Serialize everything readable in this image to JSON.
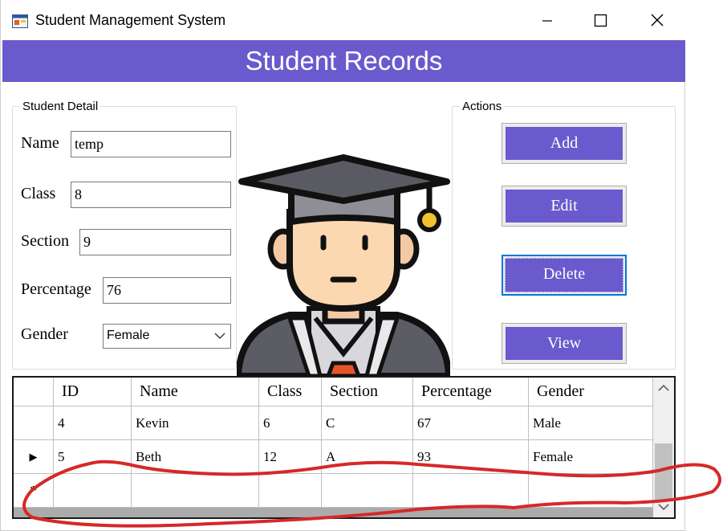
{
  "window": {
    "title": "Student Management System",
    "icons": {
      "app": "app-form-icon",
      "minimize": "minimize-icon",
      "maximize": "maximize-icon",
      "close": "close-icon"
    }
  },
  "banner": {
    "title": "Student Records",
    "color": "#6a5acd"
  },
  "student_detail": {
    "legend": "Student Detail",
    "name": {
      "label": "Name",
      "value": "temp"
    },
    "class": {
      "label": "Class",
      "value": "8"
    },
    "section": {
      "label": "Section",
      "value": "9"
    },
    "percentage": {
      "label": "Percentage",
      "value": "76"
    },
    "gender": {
      "label": "Gender",
      "selected": "Female"
    }
  },
  "actions": {
    "legend": "Actions",
    "add": "Add",
    "edit": "Edit",
    "delete": "Delete",
    "view": "View",
    "button_color": "#6a5acd"
  },
  "mascot": {
    "icon": "graduate-student-icon"
  },
  "grid": {
    "columns": [
      "ID",
      "Name",
      "Class",
      "Section",
      "Percentage",
      "Gender"
    ],
    "rows": [
      {
        "indicator": "",
        "cells": [
          "4",
          "Kevin",
          "6",
          "C",
          "67",
          "Male"
        ]
      },
      {
        "indicator": "▶",
        "cells": [
          "5",
          "Beth",
          "12",
          "A",
          "93",
          "Female"
        ]
      },
      {
        "indicator": "*",
        "cells": [
          "",
          "",
          "",
          "",
          "",
          ""
        ]
      }
    ],
    "scroll_icons": {
      "up": "chevron-up-icon",
      "down": "chevron-down-icon"
    }
  },
  "annotation": {
    "color": "#d62828"
  }
}
